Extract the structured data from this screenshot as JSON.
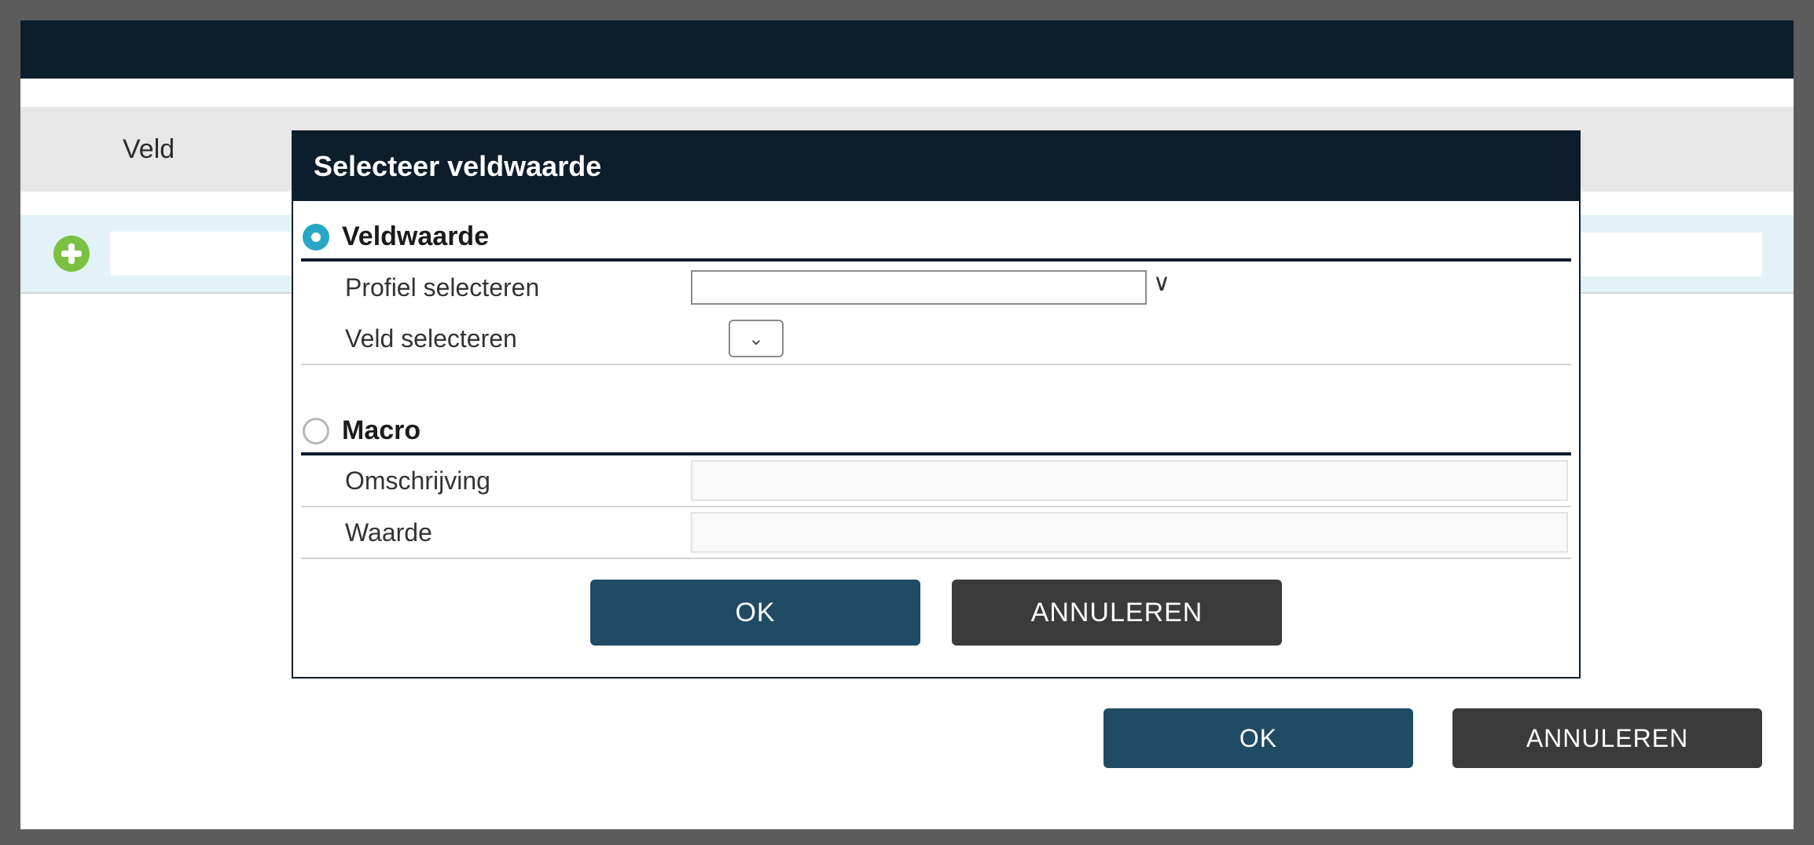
{
  "outer": {
    "column_header": "Veld",
    "ok": "OK",
    "cancel": "ANNULEREN"
  },
  "modal": {
    "title": "Selecteer veldwaarde",
    "section_veldwaarde": "Veldwaarde",
    "section_macro": "Macro",
    "profile_label": "Profiel selecteren",
    "field_label": "Veld selecteren",
    "description_label": "Omschrijving",
    "value_label": "Waarde",
    "ok": "OK",
    "cancel": "ANNULEREN",
    "select_caret": "∨"
  }
}
